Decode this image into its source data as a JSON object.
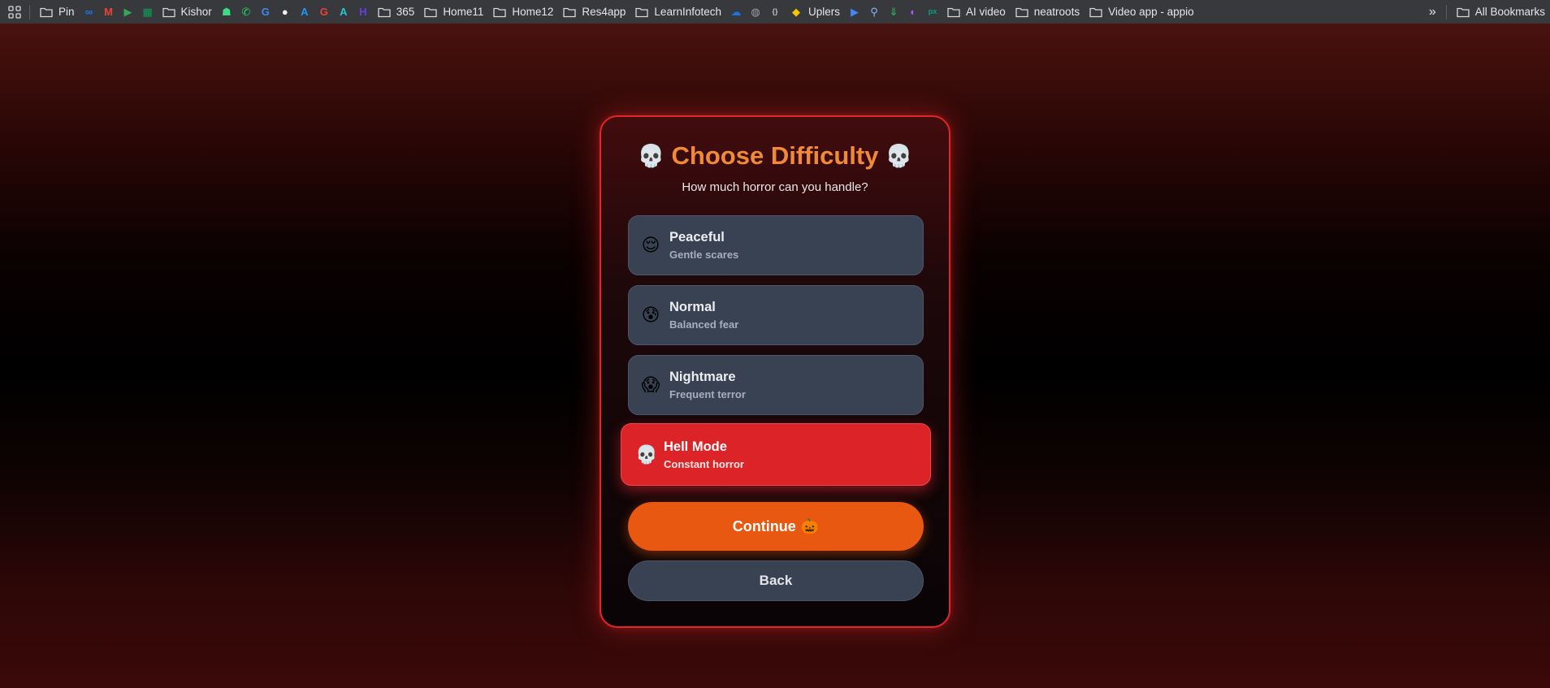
{
  "bookmarks_bar": {
    "items": [
      {
        "type": "folder",
        "label": "Pin"
      },
      {
        "type": "icon",
        "icon": "meta-icon",
        "glyph": "∞",
        "color": "#1877f2"
      },
      {
        "type": "icon",
        "icon": "gmail-icon",
        "glyph": "M",
        "color": "#ea4335"
      },
      {
        "type": "icon",
        "icon": "google-play-icon",
        "glyph": "▶",
        "color": "#34a853"
      },
      {
        "type": "icon",
        "icon": "sheets-icon",
        "glyph": "▦",
        "color": "#0f9d58"
      },
      {
        "type": "folder",
        "label": "Kishor"
      },
      {
        "type": "icon",
        "icon": "android-icon",
        "glyph": "☗",
        "color": "#3ddc84"
      },
      {
        "type": "icon",
        "icon": "whatsapp-icon",
        "glyph": "✆",
        "color": "#25d366"
      },
      {
        "type": "icon",
        "icon": "translate-icon",
        "glyph": "G",
        "color": "#4285f4"
      },
      {
        "type": "icon",
        "icon": "github-icon",
        "glyph": "●",
        "color": "#f0f0f0"
      },
      {
        "type": "icon",
        "icon": "app-store-connect-icon",
        "glyph": "A",
        "color": "#2196f3"
      },
      {
        "type": "icon",
        "icon": "google-icon",
        "glyph": "G",
        "color": "#ea4335"
      },
      {
        "type": "icon",
        "icon": "app-store-icon",
        "glyph": "A",
        "color": "#1ec8d4"
      },
      {
        "type": "icon",
        "icon": "hostinger-icon",
        "glyph": "H",
        "color": "#673de6"
      },
      {
        "type": "folder",
        "label": "365"
      },
      {
        "type": "folder",
        "label": "Home11"
      },
      {
        "type": "folder",
        "label": "Home12"
      },
      {
        "type": "folder",
        "label": "Res4app"
      },
      {
        "type": "folder",
        "label": "LearnInfotech"
      },
      {
        "type": "icon",
        "icon": "cloud-icon",
        "glyph": "☁",
        "color": "#1a73e8"
      },
      {
        "type": "icon",
        "icon": "globe-icon",
        "glyph": "◍",
        "color": "#9aa0a6"
      },
      {
        "type": "icon",
        "icon": "json-icon",
        "glyph": "{}",
        "color": "#c0c0c0"
      },
      {
        "type": "icon-label",
        "icon": "uplers-icon",
        "glyph": "◆",
        "color": "#f7c600",
        "label": "Uplers"
      },
      {
        "type": "icon",
        "icon": "google-play-icon",
        "glyph": "▶",
        "color": "#4285f4"
      },
      {
        "type": "icon",
        "icon": "pin-icon",
        "glyph": "⚲",
        "color": "#8ab4f8"
      },
      {
        "type": "icon",
        "icon": "download-icon",
        "glyph": "⇓",
        "color": "#34a853"
      },
      {
        "type": "icon",
        "icon": "figma-icon",
        "glyph": "◐",
        "color": "#a259ff"
      },
      {
        "type": "icon",
        "icon": "pexels-icon",
        "glyph": "px",
        "color": "#05a081"
      },
      {
        "type": "folder",
        "label": "AI video"
      },
      {
        "type": "folder",
        "label": "neatroots"
      },
      {
        "type": "folder",
        "label": "Video app - appio"
      }
    ],
    "overflow": "»",
    "all_bookmarks_label": "All Bookmarks"
  },
  "dialog": {
    "skull": "💀",
    "title": "Choose Difficulty",
    "subtitle": "How much horror can you handle?",
    "options": [
      {
        "emoji": "😌",
        "title": "Peaceful",
        "desc": "Gentle scares",
        "selected": false
      },
      {
        "emoji": "😰",
        "title": "Normal",
        "desc": "Balanced fear",
        "selected": false
      },
      {
        "emoji": "😱",
        "title": "Nightmare",
        "desc": "Frequent terror",
        "selected": false
      },
      {
        "emoji": "💀",
        "title": "Hell Mode",
        "desc": "Constant horror",
        "selected": true
      }
    ],
    "continue_label": "Continue",
    "continue_emoji": "🎃",
    "back_label": "Back"
  },
  "colors": {
    "accent_orange": "#f08a38",
    "continue_button": "#e85810",
    "selected_option": "#dc2428",
    "card_border": "#e3262b",
    "option_background": "#384253"
  }
}
